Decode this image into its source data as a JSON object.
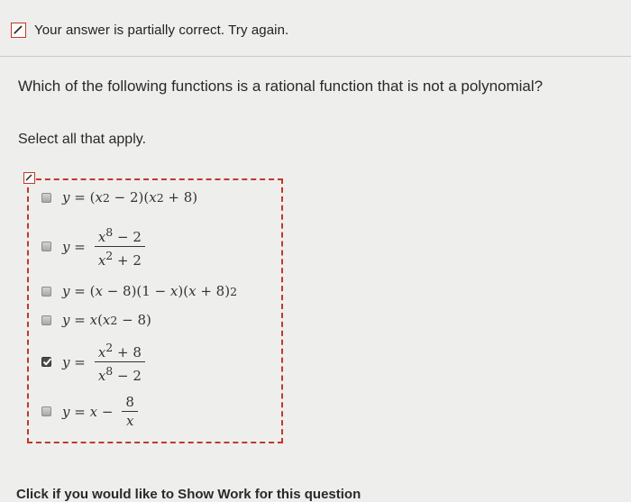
{
  "feedback": {
    "message": "Your answer is partially correct.  Try again."
  },
  "question": {
    "prompt": "Which of the following functions is a rational function that is not a polynomial?",
    "instruction": "Select all that apply."
  },
  "options": [
    {
      "latex": "y=(x^2-2)(x^2+8)",
      "checked": false
    },
    {
      "latex": "y=\\frac{x^8-2}{x^2+2}",
      "checked": false
    },
    {
      "latex": "y=(x-8)(1-x)(x+8)^2",
      "checked": false
    },
    {
      "latex": "y=x(x^2-8)",
      "checked": false
    },
    {
      "latex": "y=\\frac{x^2+8}{x^8-2}",
      "checked": true
    },
    {
      "latex": "y=x-\\frac{8}{x}",
      "checked": false
    }
  ],
  "footer": {
    "text": "Click if you would like to Show Work for this question"
  },
  "colors": {
    "error_accent": "#c0392b",
    "background": "#eeeeec"
  },
  "icons": {
    "status": "pencil-check-icon",
    "box_marker": "pencil-check-icon"
  }
}
